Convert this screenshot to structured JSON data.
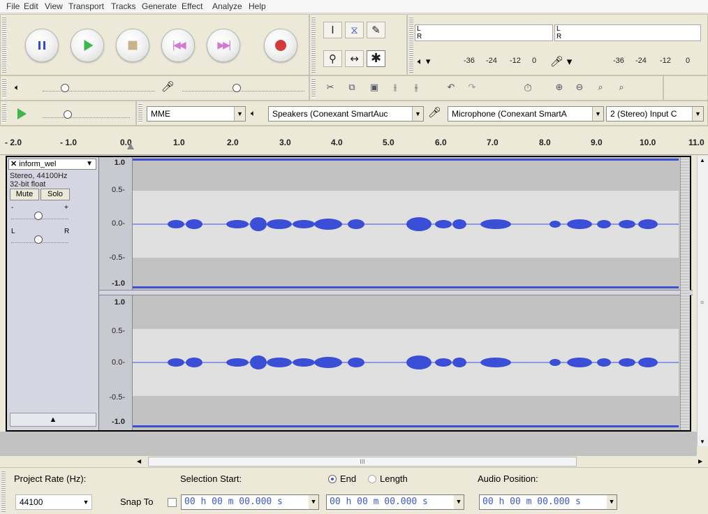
{
  "menu": [
    "File",
    "Edit",
    "View",
    "Transport",
    "Tracks",
    "Generate",
    "Effect",
    "Analyze",
    "Help"
  ],
  "meters": {
    "play": {
      "channels": [
        "L",
        "R"
      ],
      "ticks": [
        "-36",
        "-24",
        "-12",
        "0"
      ]
    },
    "rec": {
      "channels": [
        "L",
        "R"
      ],
      "ticks": [
        "-36",
        "-24",
        "-12",
        "0"
      ]
    }
  },
  "device": {
    "host": "MME",
    "output": "Speakers (Conexant SmartAuc",
    "input": "Microphone (Conexant SmartA",
    "channels": "2 (Stereo) Input C"
  },
  "ruler": {
    "labels": [
      "- 2.0",
      "- 1.0",
      "0.0",
      "1.0",
      "2.0",
      "3.0",
      "4.0",
      "5.0",
      "6.0",
      "7.0",
      "8.0",
      "9.0",
      "10.0",
      "11.0"
    ]
  },
  "track": {
    "name": "inform_wel",
    "rate": "Stereo, 44100Hz",
    "format": "32-bit float",
    "mute": "Mute",
    "solo": "Solo",
    "gain_minus": "-",
    "gain_plus": "+",
    "pan_left": "L",
    "pan_right": "R",
    "collapse": "▲"
  },
  "vscale": [
    "1.0",
    "0.5-",
    "0.0-",
    "-0.5-",
    "-1.0"
  ],
  "hscroll": {
    "grip": "III"
  },
  "selection": {
    "rate_label": "Project Rate (Hz):",
    "rate_value": "44100",
    "snap_label": "Snap To",
    "start_label": "Selection Start:",
    "end_label": "End",
    "length_label": "Length",
    "pos_label": "Audio Position:",
    "start": "00 h 00 m 00.000 s",
    "end": "00 h 00 m 00.000 s",
    "pos": "00 h 00 m 00.000 s"
  },
  "colors": {
    "waveform": "#3a4ed6",
    "track_bg": "#c2c2c2"
  }
}
